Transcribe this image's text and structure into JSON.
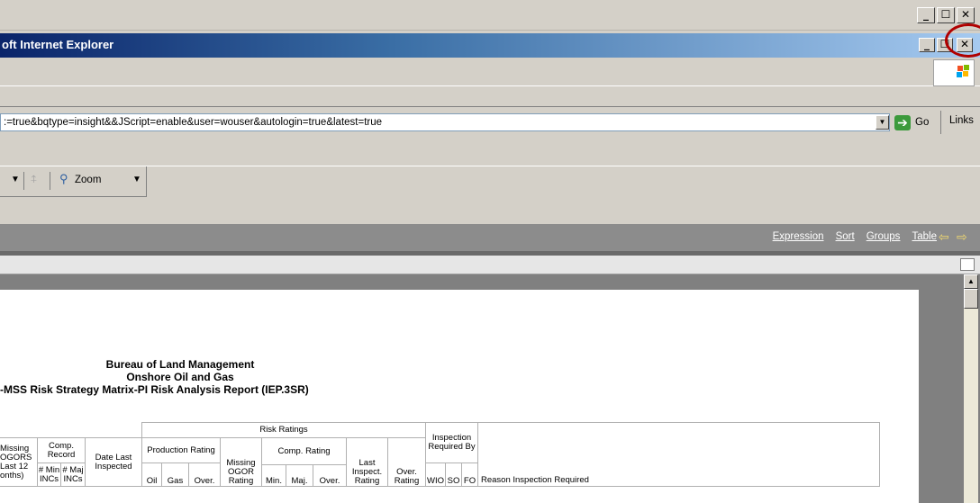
{
  "outer_window": {
    "controls": {
      "minimize": "_",
      "maximize": "☐",
      "close": "✕"
    }
  },
  "window": {
    "title": "oft Internet Explorer",
    "controls": {
      "minimize": "_",
      "maximize": "☐",
      "close": "✕"
    }
  },
  "address_bar": {
    "url": ":=true&bqtype=insight&&JScript=enable&user=wouser&autologin=true&latest=true",
    "go_label": "Go",
    "links_label": "Links"
  },
  "toolbar": {
    "zoom_label": "Zoom"
  },
  "nav": {
    "expression": "Expression",
    "sort": "Sort",
    "groups": "Groups",
    "table": "Table"
  },
  "report": {
    "title_line1": "Bureau of Land Management",
    "title_line2": "Onshore Oil and Gas",
    "title_line3": "-MSS Risk Strategy Matrix-PI Risk Analysis Report (IEP.3SR)",
    "headers": {
      "risk_ratings": "Risk Ratings",
      "inspection_required_by": "Inspection Required By",
      "missing_ogors": [
        "Missing",
        "OGORS",
        "Last 12",
        "onths)"
      ],
      "comp_record": "Comp. Record",
      "min_incs": "# Min INCs",
      "maj_incs": "# Maj INCs",
      "date_last_inspected": "Date Last Inspected",
      "production_rating": "Production Rating",
      "oil": "Oil",
      "gas": "Gas",
      "over": "Over.",
      "missing_ogor_rating": "Missing OGOR Rating",
      "comp_rating": "Comp. Rating",
      "min": "Min.",
      "maj": "Maj.",
      "last_inspect_rating": "Last Inspect. Rating",
      "over_rating": "Over. Rating",
      "wio": "WIO",
      "so": "SO",
      "fo": "FO",
      "reason": "Reason Inspection Required"
    }
  }
}
